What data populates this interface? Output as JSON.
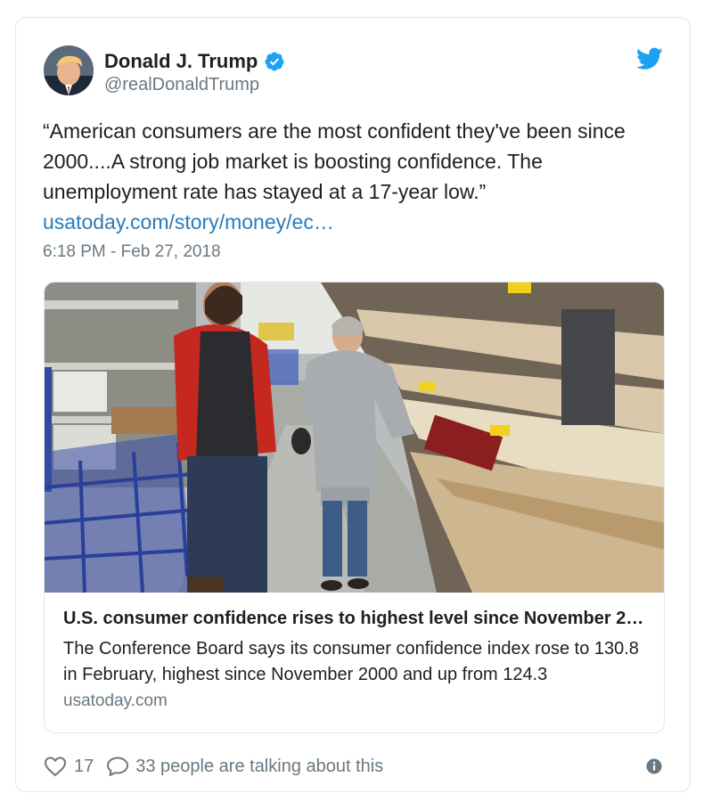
{
  "author": {
    "name": "Donald J. Trump",
    "handle": "@realDonaldTrump",
    "verified": true,
    "avatar_icon": "profile-photo"
  },
  "tweet": {
    "text_lines": [
      "“American consumers are the most confident they've been since",
      "2000....A strong job market is boosting confidence. The",
      "unemployment rate has stayed at a 17-year low.”"
    ],
    "link": "usatoday.com/story/money/ec…",
    "timestamp": "6:18 PM - Feb 27, 2018"
  },
  "card": {
    "title": "U.S. consumer confidence rises to highest level since November 2…",
    "description": "The Conference Board says its consumer confidence index rose to 130.8 in February, highest since November 2000 and up from 124.3",
    "domain": "usatoday.com",
    "photo_subject": "store-aisle-photo"
  },
  "actions": {
    "likes": "17",
    "conversation": "33 people are talking about this"
  },
  "colors": {
    "link": "#2b7bb9",
    "twitter_blue": "#1da1f2",
    "secondary": "#697882",
    "border": "#e1e8ed"
  }
}
